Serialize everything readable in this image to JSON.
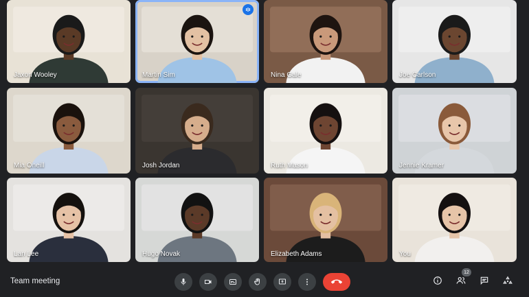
{
  "meeting": {
    "title": "Team meeting"
  },
  "participants": [
    {
      "name": "Jaxon Wooley",
      "bg": "#e8e2d6",
      "wall": "#f3efe6",
      "skin": "#5a3a26",
      "shirt": "#2f3a35",
      "hair": "#1a1a1a",
      "speaking": false
    },
    {
      "name": "Martin Sim",
      "bg": "#d8d2c8",
      "wall": "#ece8e0",
      "skin": "#e3c1a3",
      "shirt": "#9fc3e6",
      "hair": "#1b1410",
      "speaking": true
    },
    {
      "name": "Nina Gale",
      "bg": "#7a5a46",
      "wall": "#a07c64",
      "skin": "#c9997a",
      "shirt": "#f2f2f2",
      "hair": "#1e1410",
      "speaking": false
    },
    {
      "name": "Joe Carlson",
      "bg": "#e6e6e6",
      "wall": "#f4f4f4",
      "skin": "#6b4630",
      "shirt": "#8fb0cc",
      "hair": "#1a1a1a",
      "speaking": false
    },
    {
      "name": "Mia Oneill",
      "bg": "#ddd7cc",
      "wall": "#eae6de",
      "skin": "#8a5b3e",
      "shirt": "#c9d6e8",
      "hair": "#1a120d",
      "speaking": false
    },
    {
      "name": "Josh Jordan",
      "bg": "#3a3530",
      "wall": "#4b4540",
      "skin": "#d6ad8c",
      "shirt": "#2b2b2e",
      "hair": "#3a2a1e",
      "speaking": false
    },
    {
      "name": "Ruth Mason",
      "bg": "#ece9e2",
      "wall": "#f6f4ee",
      "skin": "#6e4532",
      "shirt": "#f5f5f5",
      "hair": "#151010",
      "speaking": false
    },
    {
      "name": "Jennie Kramer",
      "bg": "#cfd3d6",
      "wall": "#e3e5e7",
      "skin": "#e8c6aa",
      "shirt": "#d4d8dc",
      "hair": "#8a5a3a",
      "speaking": false
    },
    {
      "name": "Lan Lee",
      "bg": "#e4e2df",
      "wall": "#f1f0ee",
      "skin": "#e6c2a6",
      "shirt": "#2a2f3d",
      "hair": "#15110e",
      "speaking": false
    },
    {
      "name": "Hugo Novak",
      "bg": "#d6d8d6",
      "wall": "#e9eaea",
      "skin": "#5b3a28",
      "shirt": "#6d7680",
      "hair": "#121212",
      "speaking": false
    },
    {
      "name": "Elizabeth Adams",
      "bg": "#6b4a3a",
      "wall": "#8e6a56",
      "skin": "#e4c0a2",
      "shirt": "#1c1c1c",
      "hair": "#d9b479",
      "speaking": false
    },
    {
      "name": "You",
      "bg": "#e9e3da",
      "wall": "#f4efe8",
      "skin": "#e6c4a8",
      "shirt": "#f2f0ee",
      "hair": "#141010",
      "speaking": false
    }
  ],
  "controls": {
    "participant_count": "12"
  },
  "colors": {
    "background": "#202124",
    "control_bg": "#3c4043",
    "end_call": "#ea4335",
    "speaking_outline": "#8ab4f8"
  }
}
